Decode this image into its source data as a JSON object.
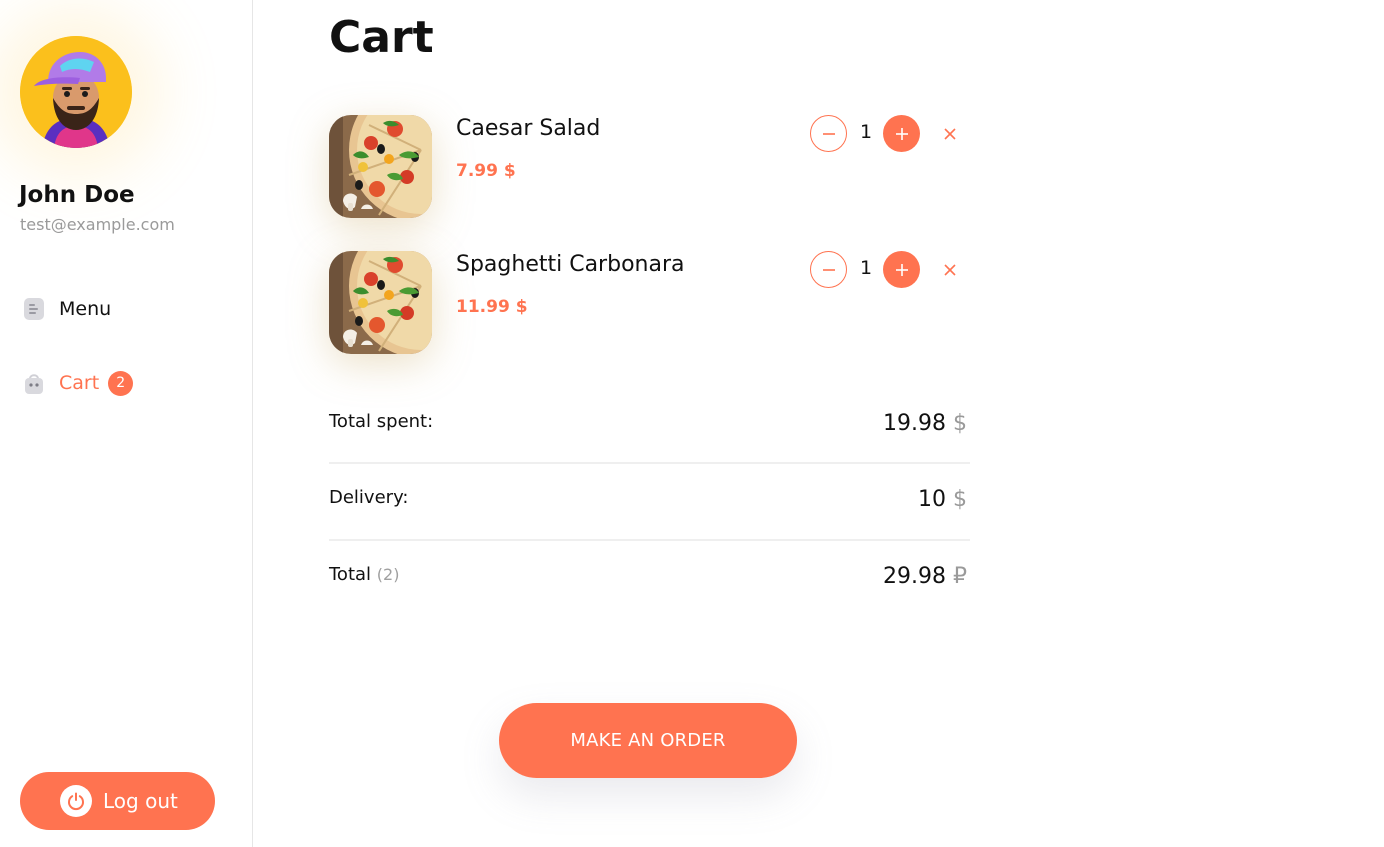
{
  "colors": {
    "accent": "#ff7350",
    "muted": "#9a9a9a",
    "divider": "#efefef",
    "avatar_bg": "#fbc01c"
  },
  "user": {
    "name": "John Doe",
    "email": "test@example.com"
  },
  "nav": {
    "items": [
      {
        "label": "Menu",
        "icon": "document-list-icon",
        "active": false
      },
      {
        "label": "Cart",
        "icon": "shopping-bag-icon",
        "active": true,
        "badge": "2"
      }
    ]
  },
  "logout": {
    "label": "Log out",
    "icon": "power-icon"
  },
  "page": {
    "title": "Cart"
  },
  "cart": {
    "items": [
      {
        "name": "Caesar Salad",
        "price": "7.99 $",
        "quantity": "1",
        "image": "pizza-photo"
      },
      {
        "name": "Spaghetti Carbonara",
        "price": "11.99 $",
        "quantity": "1",
        "image": "pizza-photo"
      }
    ]
  },
  "summary": {
    "spent_label": "Total spent:",
    "spent_value": "19.98",
    "spent_currency": "$",
    "delivery_label": "Delivery:",
    "delivery_value": "10",
    "delivery_currency": "$",
    "total_label": "Total",
    "total_count": "(2)",
    "total_value": "29.98",
    "total_currency": "₽"
  },
  "order_button": {
    "label": "MAKE AN ORDER"
  }
}
